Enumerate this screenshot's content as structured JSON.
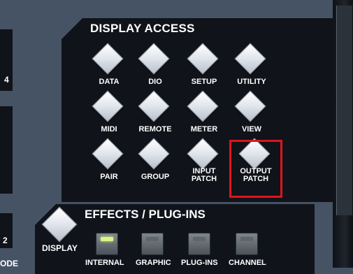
{
  "display_access": {
    "title": "DISPLAY ACCESS",
    "buttons": [
      {
        "label": "DATA"
      },
      {
        "label": "DIO"
      },
      {
        "label": "SETUP"
      },
      {
        "label": "UTILITY"
      },
      {
        "label": "MIDI"
      },
      {
        "label": "REMOTE"
      },
      {
        "label": "METER"
      },
      {
        "label": "VIEW"
      },
      {
        "label": "PAIR"
      },
      {
        "label": "GROUP"
      },
      {
        "label_line1": "INPUT",
        "label_line2": "PATCH"
      },
      {
        "label_line1": "OUTPUT",
        "label_line2": "PATCH",
        "highlighted": true
      }
    ]
  },
  "effects": {
    "title": "EFFECTS / PLUG-INS",
    "display_label": "DISPLAY",
    "buttons": [
      {
        "label": "INTERNAL",
        "led": "on"
      },
      {
        "label": "GRAPHIC",
        "led": "off"
      },
      {
        "label": "PLUG-INS",
        "led": "off"
      },
      {
        "label": "CHANNEL",
        "led": "off"
      }
    ]
  },
  "left_edge": {
    "text_top": "4",
    "text_mid": "2",
    "text_bottom": "ODE"
  },
  "colors": {
    "console_body": "#465364",
    "panel": "#101319",
    "highlight": "#e0141b",
    "led_on": "#d9f48a"
  }
}
